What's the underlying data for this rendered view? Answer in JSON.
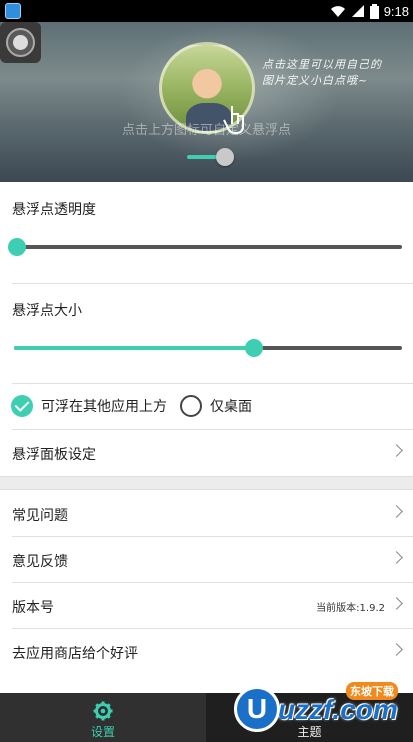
{
  "status_bar": {
    "time": "9:18"
  },
  "header": {
    "handwriting": "点击这里可以用自己的图片定义小白点哦~",
    "hint": "点击上方图标可自定义悬浮点"
  },
  "opacity_section": {
    "title": "悬浮点透明度",
    "value_fraction": 0.0
  },
  "size_section": {
    "title": "悬浮点大小",
    "value_fraction": 0.62
  },
  "float_mode": {
    "options": [
      {
        "label": "可浮在其他应用上方",
        "checked": true
      },
      {
        "label": "仅桌面",
        "checked": false
      }
    ]
  },
  "panel_settings": {
    "label": "悬浮面板设定"
  },
  "menu": {
    "faq": "常见问题",
    "feedback": "意见反馈",
    "version_label": "版本号",
    "version_value": "当前版本:1.9.2",
    "rate": "去应用商店给个好评"
  },
  "bottom_nav": {
    "settings": "设置",
    "theme": "主题"
  },
  "watermark": {
    "brand": "uzzf.com",
    "tag": "东坡下载",
    "logo_letter": "U"
  },
  "colors": {
    "accent": "#3ecfb2",
    "nav_dark": "#1f1f1f",
    "nav_active": "#303030"
  }
}
